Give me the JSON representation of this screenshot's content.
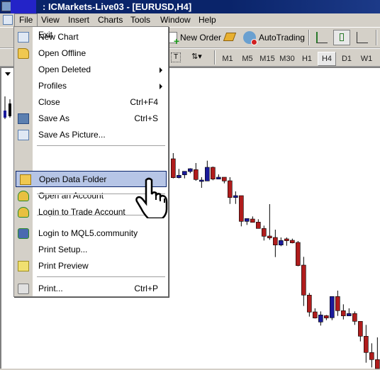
{
  "window": {
    "title": ": ICMarkets-Live03 - [EURUSD,H4]"
  },
  "menubar": [
    "File",
    "View",
    "Insert",
    "Charts",
    "Tools",
    "Window",
    "Help"
  ],
  "toolbar": {
    "new_order": "New Order",
    "autotrading": "AutoTrading"
  },
  "timeframes": {
    "items": [
      "M1",
      "M5",
      "M15",
      "M30",
      "H1",
      "H4",
      "D1",
      "W1"
    ],
    "selected": "H4"
  },
  "file_menu": {
    "items": [
      {
        "label": "New Chart",
        "icon": "new-chart-icon"
      },
      {
        "label": "Open Offline",
        "icon": "folder-open-icon"
      },
      {
        "label": "Open Deleted",
        "submenu": true
      },
      {
        "label": "Profiles",
        "submenu": true
      },
      {
        "label": "Close",
        "shortcut": "Ctrl+F4"
      },
      {
        "label": "Save As",
        "shortcut": "Ctrl+S",
        "icon": "floppy-icon"
      },
      {
        "label": "Save As Picture...",
        "icon": "save-picture-icon"
      },
      {
        "label": "Open Data Folder",
        "icon": "folder-icon",
        "highlighted": true
      },
      {
        "label": "Open an Account",
        "icon": "user-add-icon"
      },
      {
        "label": "Login to Trade Account",
        "icon": "user-login-icon"
      },
      {
        "label": "Login to MQL5.community",
        "icon": "mql5-login-icon"
      },
      {
        "label": "Print Setup..."
      },
      {
        "label": "Print Preview",
        "icon": "print-preview-icon"
      },
      {
        "label": "Print...",
        "shortcut": "Ctrl+P",
        "icon": "printer-icon"
      },
      {
        "label": "Exit"
      }
    ]
  },
  "colors": {
    "bear": "#b01c1c",
    "bull": "#1a1a9a",
    "highlight": "#b6c5e6",
    "titlebar": "#0a246a"
  }
}
